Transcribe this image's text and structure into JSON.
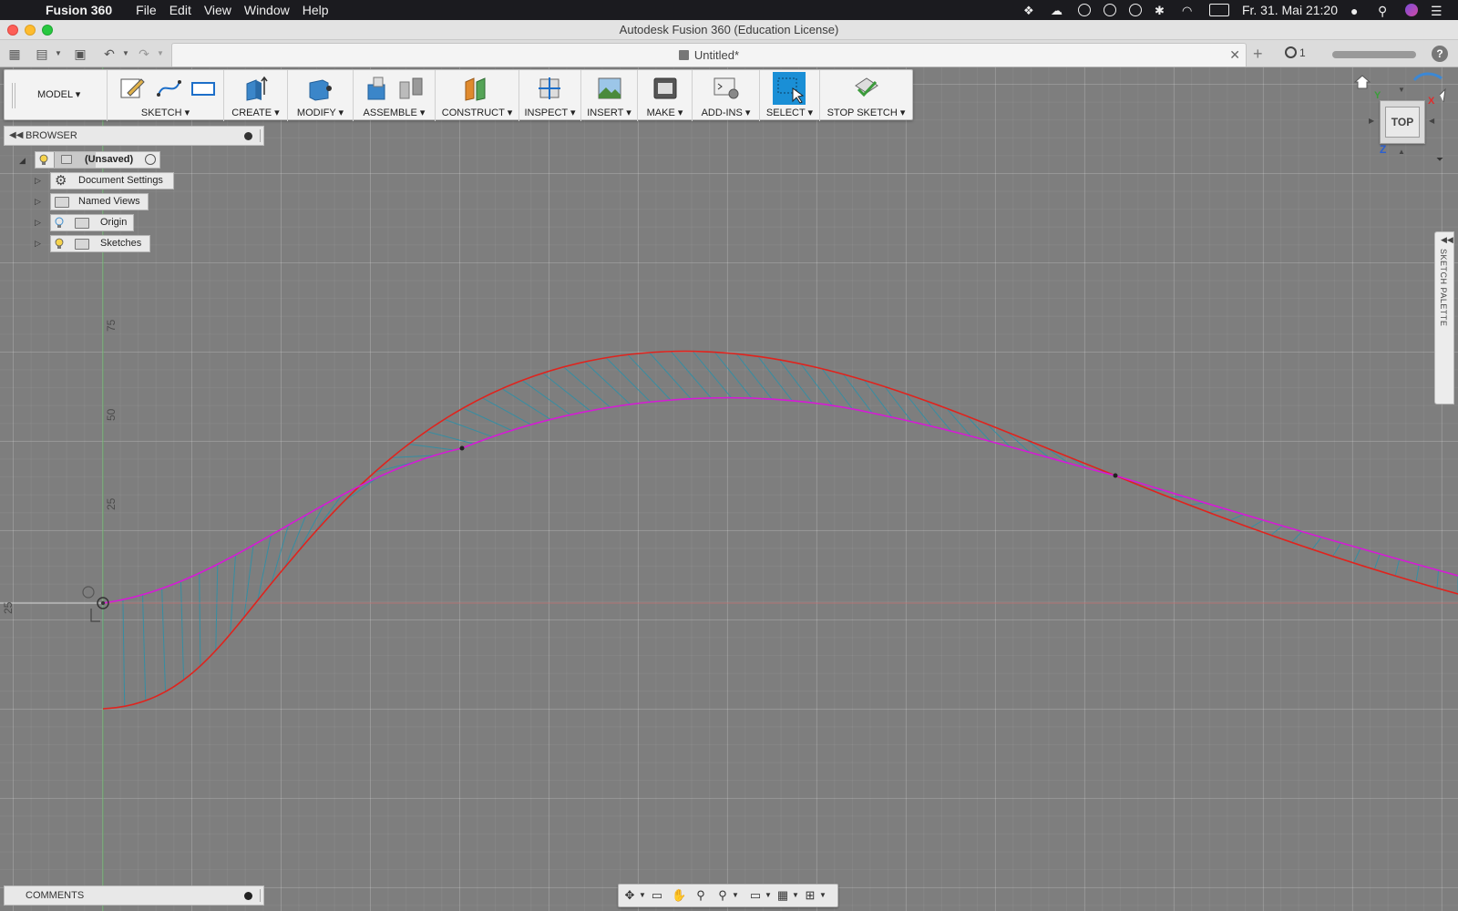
{
  "menubar": {
    "app_name": "Fusion 360",
    "items": [
      "File",
      "Edit",
      "View",
      "Window",
      "Help"
    ],
    "clock": "Fr. 31. Mai  21:20"
  },
  "window": {
    "title": "Autodesk Fusion 360 (Education License)"
  },
  "tabs": {
    "document": "Untitled*",
    "jobs_count": "1"
  },
  "toolbar": {
    "workspace": "MODEL",
    "groups": {
      "sketch": "SKETCH",
      "create": "CREATE",
      "modify": "MODIFY",
      "assemble": "ASSEMBLE",
      "construct": "CONSTRUCT",
      "inspect": "INSPECT",
      "insert": "INSERT",
      "make": "MAKE",
      "addins": "ADD-INS",
      "select": "SELECT",
      "stop_sketch": "STOP SKETCH"
    }
  },
  "browser": {
    "title": "BROWSER",
    "root": "(Unsaved)",
    "items": {
      "doc_settings": "Document Settings",
      "named_views": "Named Views",
      "origin": "Origin",
      "sketches": "Sketches"
    }
  },
  "comments": {
    "title": "COMMENTS"
  },
  "viewcube": {
    "face": "TOP",
    "axis_x": "X",
    "axis_z": "Z",
    "axis_y": "Y"
  },
  "sketch_palette": {
    "label": "SKETCH PALETTE"
  },
  "axis_ticks": {
    "v75": "75",
    "v50": "50",
    "v25": "25",
    "h25": "25"
  },
  "colors": {
    "spline_red": "#e0231d",
    "spline_magenta": "#d61ad6",
    "curvature_comb": "#2f8fa6",
    "select_blue": "#1a8fd6"
  }
}
